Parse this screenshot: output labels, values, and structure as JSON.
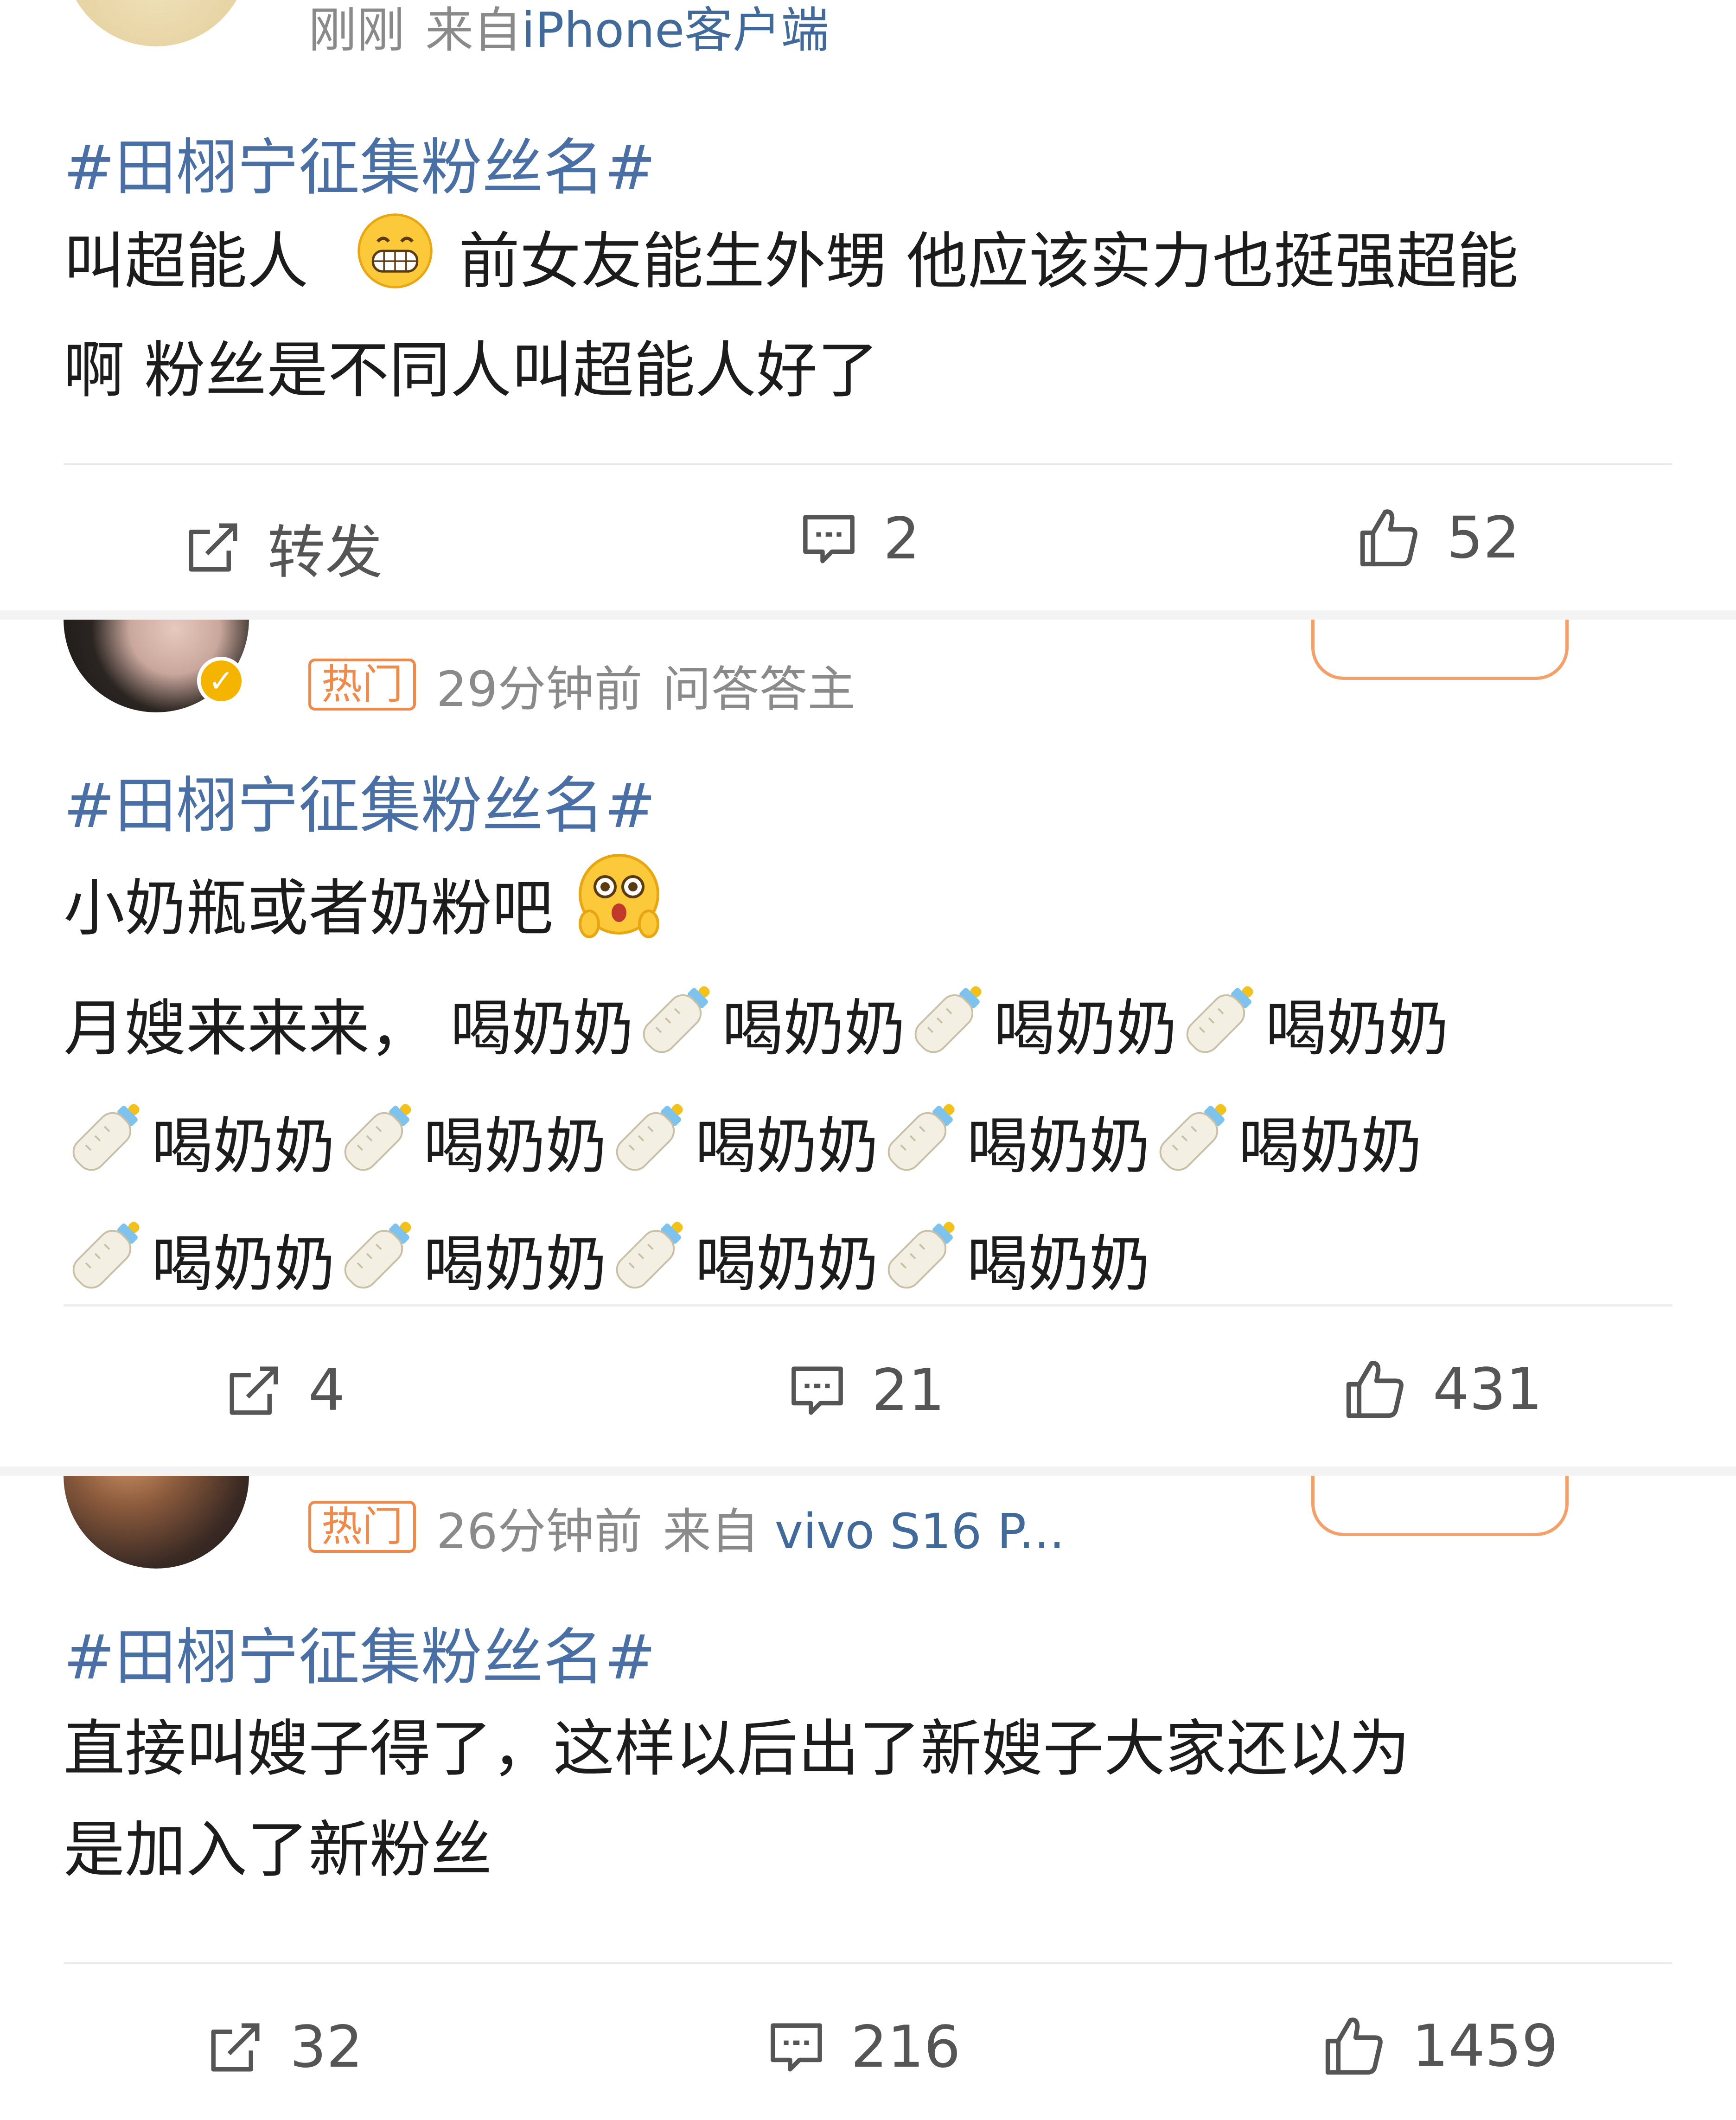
{
  "posts": [
    {
      "meta": {
        "time": "刚刚",
        "source_prefix": "来自",
        "source_name": "iPhone客户端"
      },
      "topic": "#田栩宁征集粉丝名#",
      "text_lines": [
        "叫超能人",
        "前女友能生外甥 他应该实力也挺强超能",
        "啊 粉丝是不同人叫超能人好了"
      ],
      "actions": {
        "repost": "转发",
        "comments": "2",
        "likes": "52"
      }
    },
    {
      "meta": {
        "badge": "热门",
        "time": "29分钟前",
        "source": "问答答主"
      },
      "topic": "#田栩宁征集粉丝名#",
      "text_line1": "小奶瓶或者奶粉吧",
      "text_line2_prefix": "月嫂来来来，",
      "phrase": "喝奶奶",
      "actions": {
        "repost": "4",
        "comments": "21",
        "likes": "431"
      }
    },
    {
      "meta": {
        "badge": "热门",
        "time": "26分钟前",
        "source_prefix": "来自",
        "source_name": "vivo S16 P..."
      },
      "topic": "#田栩宁征集粉丝名#",
      "text_lines": [
        "直接叫嫂子得了，这样以后出了新嫂子大家还以为",
        "是加入了新粉丝"
      ],
      "actions": {
        "repost": "32",
        "comments": "216",
        "likes": "1459"
      }
    }
  ],
  "icons": {
    "repost": "share-edit-icon",
    "comment": "comment-icon",
    "like": "thumbs-up-icon",
    "grin": "grinning-emoji",
    "bottle": "baby-bottle-emoji",
    "surprised": "surprised-emoji",
    "verified": "verified-badge-icon"
  }
}
